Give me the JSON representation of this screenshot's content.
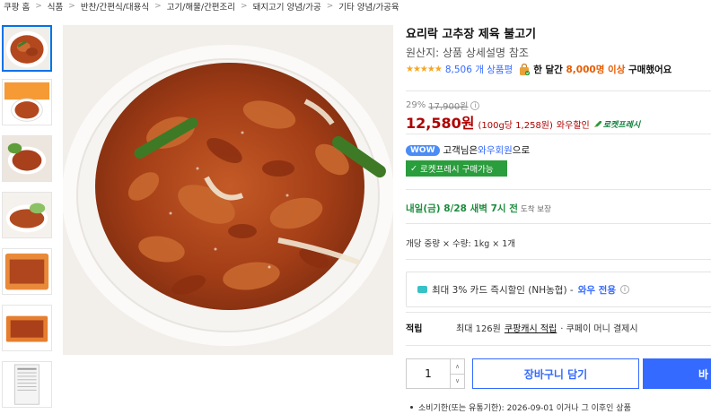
{
  "breadcrumb": [
    "쿠팡 홈",
    "식품",
    "반찬/간편식/대용식",
    "고기/해물/간편조리",
    "돼지고기 양념/가공",
    "기타 양념/가공육"
  ],
  "thumbnails": [
    {
      "name": "thumb-bulgogi-plate",
      "active": true
    },
    {
      "name": "thumb-package-front",
      "active": false
    },
    {
      "name": "thumb-bulgogi-dish",
      "active": false
    },
    {
      "name": "thumb-lettuce-wrap",
      "active": false
    },
    {
      "name": "thumb-bulgogi-closeup",
      "active": false
    },
    {
      "name": "thumb-package-pack",
      "active": false
    },
    {
      "name": "thumb-package-small",
      "active": false
    },
    {
      "name": "thumb-label",
      "active": false
    }
  ],
  "product": {
    "title": "요리락 고추장 제육 불고기",
    "origin": "원산지: 상품 상세설명 참조",
    "rating_stars": "★★★★★",
    "review_count": "8,506 개 상품평",
    "purchase_prefix": "한 달간",
    "purchase_count": "8,000명 이상",
    "purchase_suffix": "구매했어요"
  },
  "price": {
    "discount_rate": "29%",
    "original_price": "17,900원",
    "info_icon": "i",
    "sale_price": "12,580원",
    "unit_price": "(100g당 1,258원)",
    "wow_discount": "와우할인",
    "rocket_label": "로켓프레시"
  },
  "wow": {
    "tag": "WOW",
    "prefix": "고객님은",
    "link": "와우회원",
    "suffix": "으로",
    "fresh_button": "로켓프레시 구매가능"
  },
  "delivery": {
    "text": "내일(금) 8/28 새벽 7시 전",
    "note": "도착 보장"
  },
  "option": {
    "text": "개당 중량 × 수량: 1kg × 1개"
  },
  "card_offer": {
    "text": "최대 3% 카드 즉시할인 (NH농협) -",
    "wow_only": "와우 전용",
    "info_icon": "i"
  },
  "points": {
    "label": "적립",
    "prefix": "최대 126원",
    "link": "쿠팡캐시 적립",
    "suffix": "· 쿠페이 머니 결제시"
  },
  "purchase": {
    "quantity": "1",
    "cart_label": "장바구니 담기",
    "buy_label": "바"
  },
  "expiry": {
    "text": "소비기한(또는 유통기한): 2026-09-01 이거나 그 이후인 상품"
  },
  "colors": {
    "accent_blue": "#346aff",
    "price_red": "#ae0000",
    "fresh_green": "#2a9d3c",
    "star_orange": "#f5a623"
  }
}
